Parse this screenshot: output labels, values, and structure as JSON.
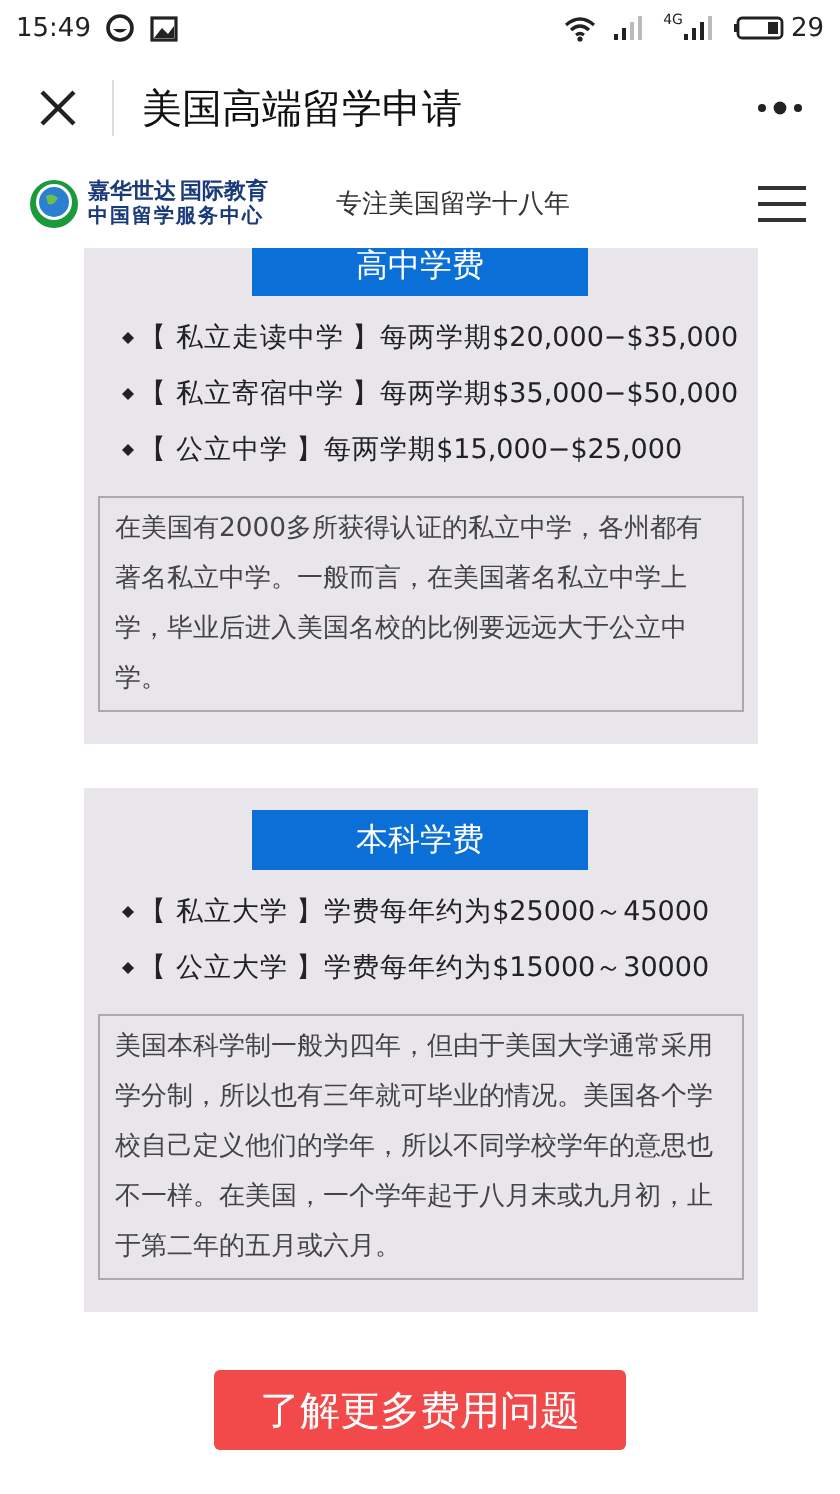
{
  "status_bar": {
    "time": "15:49",
    "battery": "29",
    "network": "4G"
  },
  "nav": {
    "title": "美国高端留学申请"
  },
  "site_header": {
    "brand_name": "嘉华世达",
    "brand_suffix": "国际教育",
    "brand_sub": "中国留学服务中心",
    "tagline": "专注美国留学十八年"
  },
  "sections": [
    {
      "heading": "高中学费",
      "items": [
        "【 私立走读中学 】每两学期$20,000−$35,000",
        "【 私立寄宿中学 】每两学期$35,000−$50,000",
        "【 公立中学 】每两学期$15,000−$25,000"
      ],
      "note": "在美国有2000多所获得认证的私立中学，各州都有著名私立中学。一般而言，在美国著名私立中学上学，毕业后进入美国名校的比例要远远大于公立中学。"
    },
    {
      "heading": "本科学费",
      "items": [
        "【 私立大学 】学费每年约为$25000～45000",
        "【 公立大学 】学费每年约为$15000～30000"
      ],
      "note": "美国本科学制一般为四年，但由于美国大学通常采用学分制，所以也有三年就可毕业的情况。美国各个学校自己定义他们的学年，所以不同学校学年的意思也不一样。在美国，一个学年起于八月末或九月初，止于第二年的五月或六月。"
    }
  ],
  "cta": {
    "label": "了解更多费用问题"
  }
}
